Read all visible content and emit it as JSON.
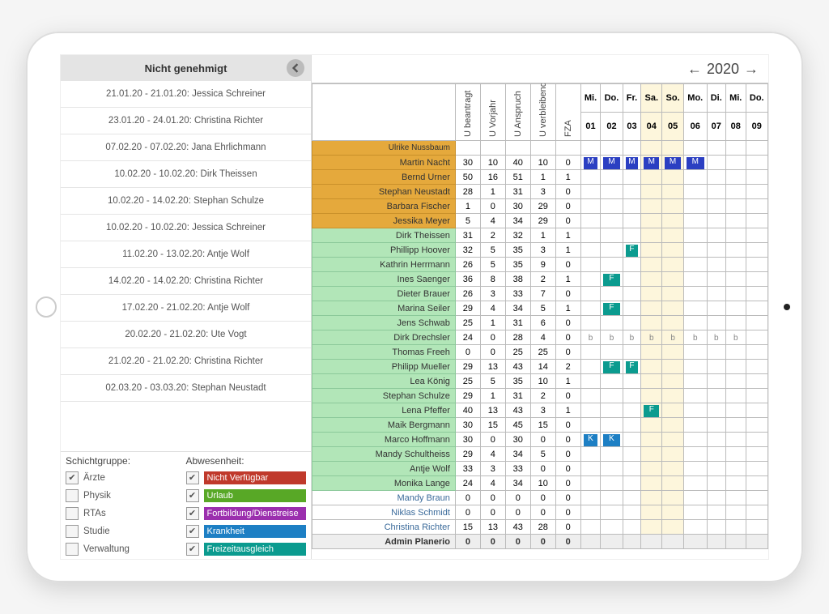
{
  "sidebar": {
    "title": "Nicht genehmigt",
    "requests": [
      "21.01.20 - 21.01.20: Jessica Schreiner",
      "23.01.20 - 24.01.20: Christina Richter",
      "07.02.20 - 07.02.20: Jana Ehrlichmann",
      "10.02.20 - 10.02.20: Dirk Theissen",
      "10.02.20 - 14.02.20: Stephan Schulze",
      "10.02.20 - 10.02.20: Jessica Schreiner",
      "11.02.20 - 13.02.20: Antje Wolf",
      "14.02.20 - 14.02.20: Christina Richter",
      "17.02.20 - 21.02.20: Antje Wolf",
      "20.02.20 - 21.02.20: Ute Vogt",
      "21.02.20 - 21.02.20: Christina Richter",
      "02.03.20 - 03.03.20: Stephan Neustadt"
    ],
    "schicht_label": "Schichtgruppe:",
    "abwesen_label": "Abwesenheit:",
    "schichtgruppen": [
      {
        "label": "Ärzte",
        "checked": true
      },
      {
        "label": "Physik",
        "checked": false
      },
      {
        "label": "RTAs",
        "checked": false
      },
      {
        "label": "Studie",
        "checked": false
      },
      {
        "label": "Verwaltung",
        "checked": false
      }
    ],
    "abwesenheiten": [
      {
        "label": "Nicht Verfügbar",
        "checked": true,
        "color": "#c0392b"
      },
      {
        "label": "Urlaub",
        "checked": true,
        "color": "#58a826"
      },
      {
        "label": "Fortbildung/Dienstreise",
        "checked": true,
        "color": "#9b2fae"
      },
      {
        "label": "Krankheit",
        "checked": true,
        "color": "#1d7fc4"
      },
      {
        "label": "Freizeitausgleich",
        "checked": true,
        "color": "#0b9b8f"
      }
    ]
  },
  "year": "2020",
  "stat_headers": [
    "U beantragt",
    "U Vorjahr",
    "U Anspruch",
    "U verbleibend",
    "FZA"
  ],
  "day_headers": [
    {
      "dow": "Mi.",
      "num": "01",
      "we": false
    },
    {
      "dow": "Do.",
      "num": "02",
      "we": false
    },
    {
      "dow": "Fr.",
      "num": "03",
      "we": false
    },
    {
      "dow": "Sa.",
      "num": "04",
      "we": true
    },
    {
      "dow": "So.",
      "num": "05",
      "we": true
    },
    {
      "dow": "Mo.",
      "num": "06",
      "we": false
    },
    {
      "dow": "Di.",
      "num": "07",
      "we": false
    },
    {
      "dow": "Mi.",
      "num": "08",
      "we": false
    },
    {
      "dow": "Do.",
      "num": "09",
      "we": false
    }
  ],
  "stub_row": "Ulrike Nussbaum",
  "rows": [
    {
      "name": "Martin Nacht",
      "g": "orange",
      "stats": [
        30,
        10,
        40,
        10,
        0
      ],
      "cells": [
        "M",
        "M",
        "M",
        "M",
        "M",
        "M",
        "",
        ""
      ]
    },
    {
      "name": "Bernd Urner",
      "g": "orange",
      "stats": [
        50,
        16,
        51,
        1,
        1
      ],
      "cells": [
        "",
        "",
        "",
        "",
        "",
        "",
        "",
        ""
      ]
    },
    {
      "name": "Stephan Neustadt",
      "g": "orange",
      "stats": [
        28,
        1,
        31,
        3,
        0
      ],
      "cells": [
        "",
        "",
        "",
        "",
        "",
        "",
        "",
        ""
      ]
    },
    {
      "name": "Barbara Fischer",
      "g": "orange",
      "stats": [
        1,
        0,
        30,
        29,
        0
      ],
      "cells": [
        "",
        "",
        "",
        "",
        "",
        "",
        "",
        ""
      ]
    },
    {
      "name": "Jessika Meyer",
      "g": "orange",
      "stats": [
        5,
        4,
        34,
        29,
        0
      ],
      "cells": [
        "",
        "",
        "",
        "",
        "",
        "",
        "",
        ""
      ]
    },
    {
      "name": "Dirk Theissen",
      "g": "green",
      "stats": [
        31,
        2,
        32,
        1,
        1
      ],
      "cells": [
        "",
        "",
        "",
        "",
        "",
        "",
        "",
        ""
      ]
    },
    {
      "name": "Phillipp Hoover",
      "g": "green",
      "stats": [
        32,
        5,
        35,
        3,
        1
      ],
      "cells": [
        "",
        "",
        "F",
        "",
        "",
        "",
        "",
        ""
      ]
    },
    {
      "name": "Kathrin Herrmann",
      "g": "green",
      "stats": [
        26,
        5,
        35,
        9,
        0
      ],
      "cells": [
        "",
        "",
        "",
        "",
        "",
        "",
        "",
        ""
      ]
    },
    {
      "name": "Ines Saenger",
      "g": "green",
      "stats": [
        36,
        8,
        38,
        2,
        1
      ],
      "cells": [
        "",
        "F",
        "",
        "",
        "",
        "",
        "",
        ""
      ]
    },
    {
      "name": "Dieter Brauer",
      "g": "green",
      "stats": [
        26,
        3,
        33,
        7,
        0
      ],
      "cells": [
        "",
        "",
        "",
        "",
        "",
        "",
        "",
        ""
      ]
    },
    {
      "name": "Marina Seiler",
      "g": "green",
      "stats": [
        29,
        4,
        34,
        5,
        1
      ],
      "cells": [
        "",
        "F",
        "",
        "",
        "",
        "",
        "",
        ""
      ]
    },
    {
      "name": "Jens Schwab",
      "g": "green",
      "stats": [
        25,
        1,
        31,
        6,
        0
      ],
      "cells": [
        "",
        "",
        "",
        "",
        "",
        "",
        "",
        ""
      ]
    },
    {
      "name": "Dirk Drechsler",
      "g": "green",
      "stats": [
        24,
        0,
        28,
        4,
        0
      ],
      "cells": [
        "b",
        "b",
        "b",
        "b",
        "b",
        "b",
        "b",
        "b"
      ]
    },
    {
      "name": "Thomas Freeh",
      "g": "green",
      "stats": [
        0,
        0,
        25,
        25,
        0
      ],
      "cells": [
        "",
        "",
        "",
        "",
        "",
        "",
        "",
        ""
      ]
    },
    {
      "name": "Philipp Mueller",
      "g": "green",
      "stats": [
        29,
        13,
        43,
        14,
        2
      ],
      "cells": [
        "",
        "F",
        "F",
        "",
        "",
        "",
        "",
        ""
      ]
    },
    {
      "name": "Lea König",
      "g": "green",
      "stats": [
        25,
        5,
        35,
        10,
        1
      ],
      "cells": [
        "",
        "",
        "",
        "",
        "",
        "",
        "",
        ""
      ]
    },
    {
      "name": "Stephan Schulze",
      "g": "green",
      "stats": [
        29,
        1,
        31,
        2,
        0
      ],
      "cells": [
        "",
        "",
        "",
        "",
        "",
        "",
        "",
        ""
      ]
    },
    {
      "name": "Lena Pfeffer",
      "g": "green",
      "stats": [
        40,
        13,
        43,
        3,
        1
      ],
      "cells": [
        "",
        "",
        "",
        "F",
        "",
        "",
        "",
        ""
      ]
    },
    {
      "name": "Maik Bergmann",
      "g": "green",
      "stats": [
        30,
        15,
        45,
        15,
        0
      ],
      "cells": [
        "",
        "",
        "",
        "",
        "",
        "",
        "",
        ""
      ]
    },
    {
      "name": "Marco Hoffmann",
      "g": "green",
      "stats": [
        30,
        0,
        30,
        0,
        0
      ],
      "cells": [
        "K",
        "K",
        "",
        "",
        "",
        "",
        "",
        ""
      ]
    },
    {
      "name": "Mandy Schultheiss",
      "g": "green",
      "stats": [
        29,
        4,
        34,
        5,
        0
      ],
      "cells": [
        "",
        "",
        "",
        "",
        "",
        "",
        "",
        ""
      ]
    },
    {
      "name": "Antje Wolf",
      "g": "green",
      "stats": [
        33,
        3,
        33,
        0,
        0
      ],
      "cells": [
        "",
        "",
        "",
        "",
        "",
        "",
        "",
        ""
      ]
    },
    {
      "name": "Monika Lange",
      "g": "green",
      "stats": [
        24,
        4,
        34,
        10,
        0
      ],
      "cells": [
        "",
        "",
        "",
        "",
        "",
        "",
        "",
        ""
      ]
    },
    {
      "name": "Mandy Braun",
      "g": "white",
      "stats": [
        0,
        0,
        0,
        0,
        0
      ],
      "cells": [
        "",
        "",
        "",
        "",
        "",
        "",
        "",
        ""
      ]
    },
    {
      "name": "Niklas Schmidt",
      "g": "white",
      "stats": [
        0,
        0,
        0,
        0,
        0
      ],
      "cells": [
        "",
        "",
        "",
        "",
        "",
        "",
        "",
        ""
      ]
    },
    {
      "name": "Christina Richter",
      "g": "white",
      "stats": [
        15,
        13,
        43,
        28,
        0
      ],
      "cells": [
        "",
        "",
        "",
        "",
        "",
        "",
        "",
        ""
      ]
    },
    {
      "name": "Admin Planerio",
      "g": "admin",
      "stats": [
        0,
        0,
        0,
        0,
        0
      ],
      "cells": [
        "",
        "",
        "",
        "",
        "",
        "",
        "",
        ""
      ]
    }
  ]
}
